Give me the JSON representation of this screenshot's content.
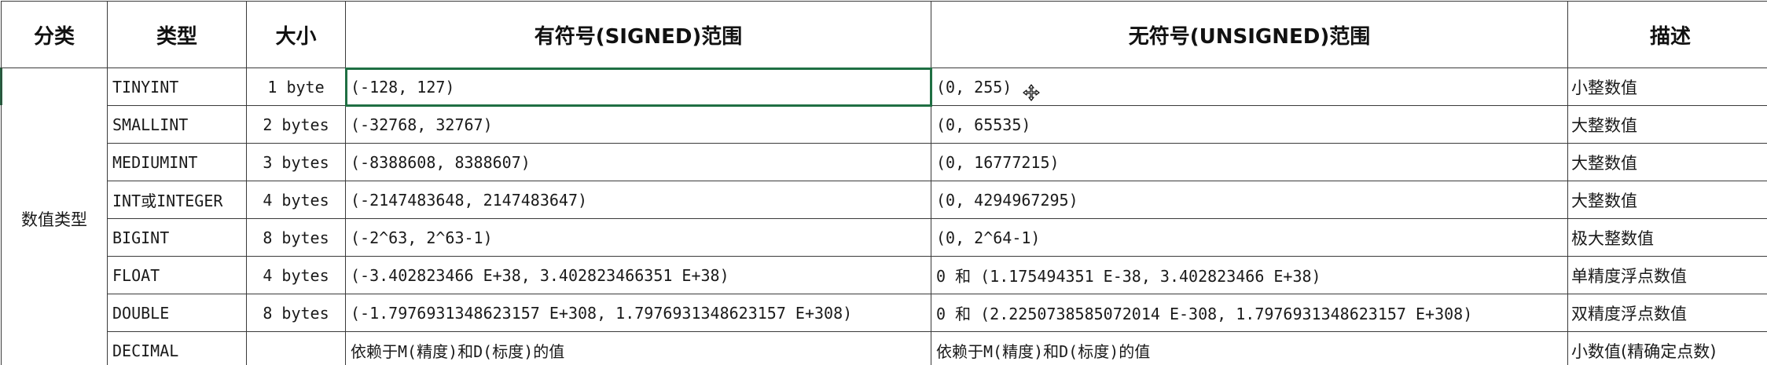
{
  "headers": {
    "category": "分类",
    "type": "类型",
    "size": "大小",
    "signed_range": "有符号(SIGNED)范围",
    "unsigned_range": "无符号(UNSIGNED)范围",
    "description": "描述"
  },
  "category_label": "数值类型",
  "rows": [
    {
      "type": "TINYINT",
      "size": "1 byte",
      "signed": "(-128, 127)",
      "unsigned": "(0, 255)",
      "desc": "小整数值"
    },
    {
      "type": "SMALLINT",
      "size": "2 bytes",
      "signed": "(-32768, 32767)",
      "unsigned": "(0, 65535)",
      "desc": "大整数值"
    },
    {
      "type": "MEDIUMINT",
      "size": "3 bytes",
      "signed": "(-8388608, 8388607)",
      "unsigned": "(0, 16777215)",
      "desc": "大整数值"
    },
    {
      "type": "INT或INTEGER",
      "size": "4 bytes",
      "signed": "(-2147483648, 2147483647)",
      "unsigned": "(0, 4294967295)",
      "desc": "大整数值"
    },
    {
      "type": "BIGINT",
      "size": "8 bytes",
      "signed": "(-2^63, 2^63-1)",
      "unsigned": "(0, 2^64-1)",
      "desc": "极大整数值"
    },
    {
      "type": "FLOAT",
      "size": "4 bytes",
      "signed": "(-3.402823466 E+38, 3.402823466351 E+38)",
      "unsigned": "0 和 (1.175494351 E-38, 3.402823466 E+38)",
      "desc": "单精度浮点数值"
    },
    {
      "type": "DOUBLE",
      "size": "8 bytes",
      "signed": "(-1.7976931348623157 E+308, 1.7976931348623157 E+308)",
      "unsigned": "0 和 (2.2250738585072014 E-308, 1.7976931348623157 E+308)",
      "desc": "双精度浮点数值"
    },
    {
      "type": "DECIMAL",
      "size": "",
      "signed": "依赖于M(精度)和D(标度)的值",
      "unsigned": "依赖于M(精度)和D(标度)的值",
      "desc": "小数值(精确定点数)"
    }
  ],
  "icons": {
    "cursor": "move-cursor-icon"
  },
  "colors": {
    "selection": "#1f6f43",
    "border": "#3a3a3a",
    "text": "#1a1a1a"
  }
}
